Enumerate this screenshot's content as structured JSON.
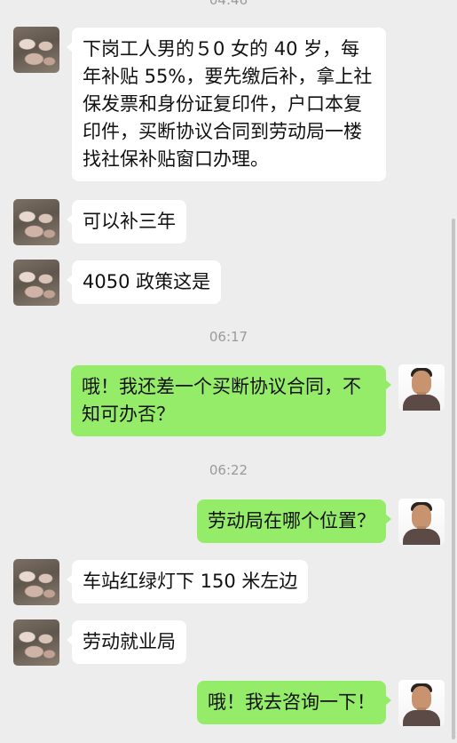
{
  "timestamps": {
    "top_partial": "04:46",
    "t1": "06:17",
    "t2": "06:22"
  },
  "messages": [
    {
      "side": "in",
      "avatar": "pig-photo-avatar",
      "text": "下岗工人男的５0 女的 40 岁，每年补贴 55%，要先缴后补，拿上社保发票和身份证复印件，户口本复印件，买断协议合同到劳动局一楼找社保补贴窗口办理。"
    },
    {
      "side": "in",
      "avatar": "pig-photo-avatar",
      "text": "可以补三年"
    },
    {
      "side": "in",
      "avatar": "pig-photo-avatar",
      "text": "4050 政策这是"
    },
    {
      "side": "out",
      "avatar": "man-portrait-avatar",
      "text": "哦！我还差一个买断协议合同，不知可办否？"
    },
    {
      "side": "out",
      "avatar": "man-portrait-avatar",
      "text": "劳动局在哪个位置？"
    },
    {
      "side": "in",
      "avatar": "pig-photo-avatar",
      "text": "车站红绿灯下 150 米左边"
    },
    {
      "side": "in",
      "avatar": "pig-photo-avatar",
      "text": "劳动就业局"
    },
    {
      "side": "out",
      "avatar": "man-portrait-avatar",
      "text": "哦！我去咨询一下！"
    }
  ],
  "colors": {
    "background": "#ededed",
    "incoming_bubble": "#ffffff",
    "outgoing_bubble": "#95ec69",
    "timestamp_text": "#9a9a9a"
  }
}
